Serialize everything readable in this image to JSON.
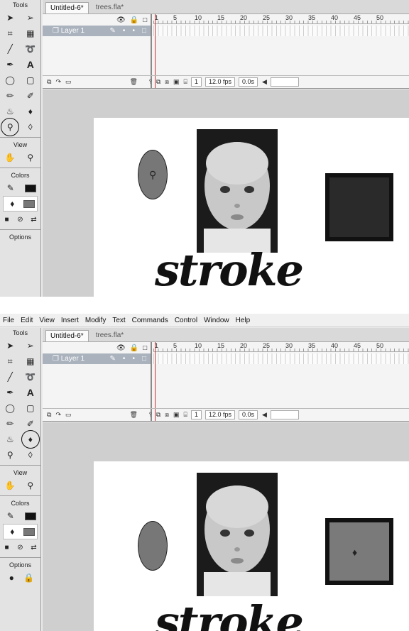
{
  "menu": [
    "File",
    "Edit",
    "View",
    "Insert",
    "Modify",
    "Text",
    "Commands",
    "Control",
    "Window",
    "Help"
  ],
  "tools": {
    "title": "Tools",
    "view_label": "View",
    "colors_label": "Colors",
    "options_label": "Options",
    "glyphs": {
      "arrow": "➤",
      "subselect": "➢",
      "free_transform": "⌗",
      "gradient": "▦",
      "line": "╱",
      "lasso": "➰",
      "pen": "✒",
      "text": "A",
      "oval": "◯",
      "rect": "▢",
      "pencil": "✏",
      "brush": "🖌",
      "ink_bottle": "⚱",
      "paint_bucket": "🪣",
      "eyedropper": "⚲",
      "eraser": "⌫",
      "hand": "✋",
      "zoom": "🔍",
      "stroke": "✎",
      "fill": "⛾",
      "swap": "⇄"
    }
  },
  "tabs": [
    "Untitled-6*",
    "trees.fla*"
  ],
  "timeline": {
    "layer_name": "Layer 1",
    "ruler_numbers": [
      "1",
      "5",
      "10",
      "15",
      "20",
      "25",
      "30",
      "35",
      "40",
      "45",
      "50"
    ],
    "frame": "1",
    "fps": "12.0 fps",
    "time": "0.0s"
  },
  "stage": {
    "word": "stroke"
  }
}
